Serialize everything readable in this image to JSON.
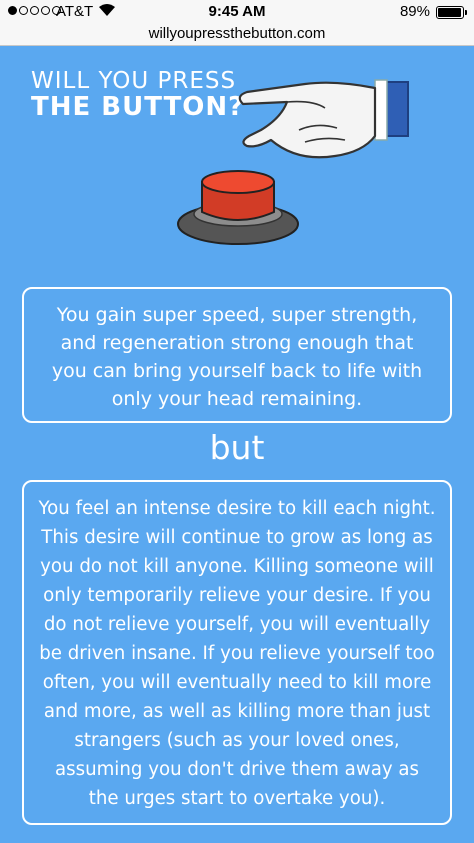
{
  "status_bar": {
    "carrier": "AT&T",
    "time": "9:45 AM",
    "battery": "89%",
    "battery_level": 0.89,
    "signal_bars": 1
  },
  "browser": {
    "url": "willyoupressthebutton.com"
  },
  "header": {
    "title_line1": "WILL YOU PRESS",
    "title_line2": "THE BUTTON?"
  },
  "content": {
    "benefit": "You gain super speed, super strength, and regeneration strong enough that you can bring yourself back to life with only your head remaining.",
    "connector": "but",
    "drawback": "You feel an intense desire to kill each night. This desire will continue to grow as long as you do not kill anyone. Killing someone will only temporarily relieve your desire. If you do not relieve yourself, you will eventually be driven insane. If you relieve yourself too often, you will eventually need to kill more and more, as well as killing more than just strangers (such as your loved ones, assuming you don't drive them away as the urges start to overtake you)."
  },
  "colors": {
    "background": "#5aa8f0",
    "button_red": "#e0412c",
    "button_base": "#555555"
  }
}
